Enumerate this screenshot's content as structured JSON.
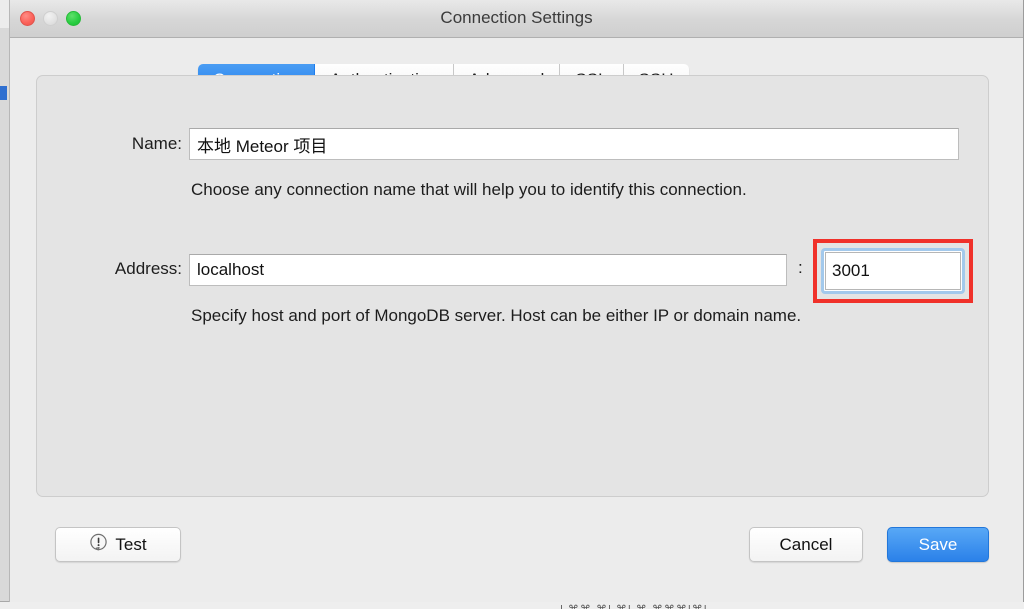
{
  "window": {
    "title": "Connection Settings",
    "traffic_lights": [
      {
        "name": "close",
        "color": "#fb6058"
      },
      {
        "name": "minimize",
        "color": "#e2e2e2"
      },
      {
        "name": "zoom",
        "color": "#28cd41"
      }
    ]
  },
  "tabs": [
    {
      "label": "Connection",
      "active": true
    },
    {
      "label": "Authentication",
      "active": false
    },
    {
      "label": "Advanced",
      "active": false
    },
    {
      "label": "SSL",
      "active": false
    },
    {
      "label": "SSH",
      "active": false
    }
  ],
  "form": {
    "name": {
      "label": "Name:",
      "value": "本地 Meteor 项目",
      "placeholder": "",
      "hint": "Choose any connection name that will help you to identify this connection."
    },
    "address": {
      "label": "Address:",
      "host_value": "localhost",
      "host_placeholder": "",
      "separator": ":",
      "port_value": "3001",
      "port_placeholder": "",
      "port_focused": true,
      "hint": "Specify host and port of MongoDB server. Host can be either IP or domain name."
    }
  },
  "annotation": {
    "highlight_color": "#f0312a",
    "target": "port-input"
  },
  "footer": {
    "test_label": "Test",
    "test_icon": "exclamation-bubble-icon",
    "cancel_label": "Cancel",
    "save_label": "Save"
  },
  "colors": {
    "accent": "#2b81e9",
    "window_bg": "#ececec",
    "panel_bg": "#e4e4e4",
    "highlight": "#f0312a"
  },
  "background": {
    "bottom_sliver_text": "|  ⌘⌘ ⌘|     ⌘|  ⌘ ⌘⌘⌘|⌘|"
  }
}
